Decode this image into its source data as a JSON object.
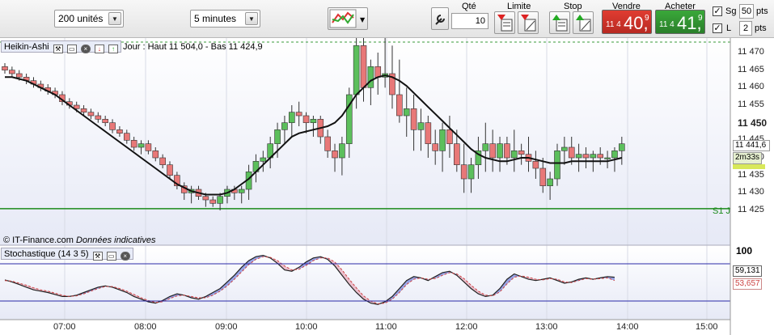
{
  "toolbar": {
    "units_select": "200 unités",
    "interval_select": "5 minutes",
    "qty_label": "Qté",
    "qty_value": "10",
    "limit_label": "Limite",
    "stop_label": "Stop",
    "sell_label": "Vendre",
    "buy_label": "Acheter",
    "sell_price_small": "11 4",
    "sell_price_big": "40,",
    "sell_price_sup": "9",
    "buy_price_small": "11 4",
    "buy_price_big": "41,",
    "buy_price_sup": "9",
    "sg_label": "Sg",
    "sg_value": "50",
    "sg_unit": "pts",
    "l_label": "L",
    "l_value": "2",
    "l_unit": "pts",
    "sell_color": "#e03c31",
    "buy_color": "#3aa83a"
  },
  "price_panel": {
    "title": "Heikin-Ashi",
    "info": "Jour : Haut 11 504,0 - Bas 11 424,9",
    "watermark_source": "© IT-Finance.com",
    "watermark_note": "Données indicatives",
    "support_label": "S1 J",
    "last_price": "11 441,6",
    "countdown": "2m33s",
    "y_ticks": [
      "11 470",
      "11 465",
      "11 460",
      "11 455",
      "11 450",
      "11 445",
      "11 440",
      "11 435",
      "11 430",
      "11 425"
    ],
    "bold_tick": "11 450"
  },
  "stoch_panel": {
    "title": "Stochastique (14 3 5)",
    "top_tick": "100",
    "k_value": "59,131",
    "d_value": "53,657"
  },
  "x_ticks": [
    "07:00",
    "08:00",
    "09:00",
    "10:00",
    "11:00",
    "12:00",
    "13:00",
    "14:00",
    "15:00"
  ],
  "chart_data": {
    "type": "candlestick",
    "ylim": [
      11422,
      11473
    ],
    "up_color": "#5cbf5c",
    "down_color": "#e87878",
    "candles": [
      [
        11466,
        11467,
        11464,
        11465
      ],
      [
        11465,
        11466,
        11463,
        11464
      ],
      [
        11464,
        11465,
        11462,
        11463
      ],
      [
        11463,
        11464,
        11461,
        11462
      ],
      [
        11462,
        11463,
        11460,
        11461
      ],
      [
        11461,
        11462,
        11459,
        11460
      ],
      [
        11460,
        11461,
        11458,
        11459
      ],
      [
        11459,
        11460,
        11457,
        11458
      ],
      [
        11458,
        11459,
        11455,
        11456
      ],
      [
        11456,
        11457,
        11454,
        11455
      ],
      [
        11455,
        11456,
        11453,
        11454
      ],
      [
        11454,
        11455,
        11452,
        11453
      ],
      [
        11453,
        11454,
        11451,
        11452
      ],
      [
        11452,
        11453,
        11450,
        11451
      ],
      [
        11451,
        11452,
        11449,
        11450
      ],
      [
        11450,
        11451,
        11447,
        11448
      ],
      [
        11448,
        11449,
        11446,
        11447
      ],
      [
        11447,
        11448,
        11444,
        11445
      ],
      [
        11445,
        11446,
        11442,
        11443
      ],
      [
        11443,
        11445,
        11441,
        11444
      ],
      [
        11444,
        11445,
        11441,
        11442
      ],
      [
        11442,
        11443,
        11439,
        11440
      ],
      [
        11440,
        11441,
        11437,
        11438
      ],
      [
        11438,
        11439,
        11434,
        11435
      ],
      [
        11435,
        11436,
        11431,
        11432
      ],
      [
        11432,
        11433,
        11428,
        11430
      ],
      [
        11430,
        11432,
        11427,
        11431
      ],
      [
        11431,
        11432,
        11428,
        11429
      ],
      [
        11429,
        11430,
        11426,
        11428
      ],
      [
        11428,
        11429,
        11426,
        11427
      ],
      [
        11427,
        11430,
        11425,
        11429
      ],
      [
        11429,
        11432,
        11427,
        11431
      ],
      [
        11431,
        11432,
        11428,
        11430
      ],
      [
        11430,
        11432,
        11427,
        11431
      ],
      [
        11431,
        11438,
        11428,
        11436
      ],
      [
        11436,
        11441,
        11433,
        11439
      ],
      [
        11439,
        11442,
        11436,
        11440
      ],
      [
        11440,
        11446,
        11437,
        11444
      ],
      [
        11444,
        11450,
        11440,
        11448
      ],
      [
        11448,
        11452,
        11444,
        11450
      ],
      [
        11450,
        11455,
        11446,
        11453
      ],
      [
        11453,
        11456,
        11449,
        11452
      ],
      [
        11452,
        11453,
        11447,
        11450
      ],
      [
        11450,
        11452,
        11446,
        11451
      ],
      [
        11451,
        11452,
        11444,
        11446
      ],
      [
        11446,
        11448,
        11440,
        11442
      ],
      [
        11442,
        11444,
        11436,
        11440
      ],
      [
        11440,
        11446,
        11435,
        11444
      ],
      [
        11444,
        11460,
        11440,
        11458
      ],
      [
        11458,
        11475,
        11454,
        11472
      ],
      [
        11472,
        11476,
        11456,
        11460
      ],
      [
        11460,
        11468,
        11455,
        11466
      ],
      [
        11466,
        11470,
        11458,
        11463
      ],
      [
        11463,
        11475,
        11460,
        11464
      ],
      [
        11464,
        11472,
        11454,
        11458
      ],
      [
        11458,
        11468,
        11450,
        11452
      ],
      [
        11452,
        11460,
        11446,
        11454
      ],
      [
        11454,
        11458,
        11442,
        11448
      ],
      [
        11448,
        11454,
        11442,
        11450
      ],
      [
        11450,
        11452,
        11440,
        11444
      ],
      [
        11444,
        11448,
        11438,
        11442
      ],
      [
        11442,
        11450,
        11436,
        11448
      ],
      [
        11448,
        11452,
        11440,
        11444
      ],
      [
        11444,
        11448,
        11436,
        11438
      ],
      [
        11438,
        11444,
        11430,
        11434
      ],
      [
        11434,
        11440,
        11430,
        11438
      ],
      [
        11438,
        11446,
        11434,
        11442
      ],
      [
        11442,
        11450,
        11436,
        11444
      ],
      [
        11444,
        11448,
        11436,
        11440
      ],
      [
        11440,
        11446,
        11436,
        11444
      ],
      [
        11444,
        11446,
        11438,
        11440
      ],
      [
        11440,
        11448,
        11436,
        11442
      ],
      [
        11442,
        11444,
        11438,
        11441
      ],
      [
        11441,
        11446,
        11436,
        11439
      ],
      [
        11439,
        11442,
        11434,
        11437
      ],
      [
        11437,
        11440,
        11430,
        11432
      ],
      [
        11432,
        11436,
        11428,
        11434
      ],
      [
        11434,
        11444,
        11432,
        11442
      ],
      [
        11442,
        11446,
        11438,
        11443
      ],
      [
        11443,
        11446,
        11438,
        11440
      ],
      [
        11440,
        11444,
        11436,
        11441
      ],
      [
        11441,
        11443,
        11437,
        11440
      ],
      [
        11440,
        11442,
        11436,
        11441
      ],
      [
        11441,
        11443,
        11438,
        11440
      ],
      [
        11440,
        11442,
        11437,
        11440
      ],
      [
        11440,
        11443,
        11436,
        11442
      ],
      [
        11442,
        11446,
        11438,
        11444
      ]
    ],
    "ma_series": [
      11463,
      11463,
      11462.5,
      11462,
      11461,
      11460,
      11459,
      11458,
      11456.5,
      11455,
      11453.5,
      11452,
      11450.5,
      11449,
      11447.5,
      11446,
      11444.5,
      11443,
      11441.5,
      11440,
      11438.5,
      11437,
      11435.5,
      11434,
      11432.5,
      11431.5,
      11430.5,
      11430,
      11429.5,
      11429.5,
      11429.5,
      11430,
      11431,
      11432.5,
      11434,
      11436,
      11438,
      11440,
      11442,
      11444,
      11446,
      11447,
      11447.5,
      11448,
      11448.5,
      11449,
      11450,
      11452,
      11455,
      11458,
      11460,
      11462,
      11463,
      11463.5,
      11463,
      11462,
      11460.5,
      11458.5,
      11456.5,
      11454.5,
      11452.5,
      11450.5,
      11448.5,
      11446.5,
      11444.5,
      11442.5,
      11441,
      11440,
      11439.5,
      11439,
      11439,
      11439.5,
      11440,
      11440,
      11439.5,
      11439,
      11438.5,
      11438.5,
      11438.5,
      11439,
      11439,
      11439,
      11439,
      11439,
      11439,
      11439.5,
      11440
    ],
    "support": 11425.5,
    "stoch_k": [
      55,
      52,
      48,
      44,
      40,
      38,
      36,
      33,
      30,
      30,
      32,
      36,
      40,
      44,
      46,
      44,
      40,
      36,
      30,
      26,
      22,
      20,
      24,
      30,
      34,
      32,
      28,
      26,
      30,
      36,
      42,
      52,
      62,
      74,
      84,
      90,
      92,
      88,
      80,
      70,
      68,
      74,
      82,
      88,
      90,
      86,
      76,
      62,
      48,
      36,
      26,
      20,
      18,
      22,
      30,
      42,
      54,
      60,
      58,
      54,
      60,
      66,
      68,
      62,
      52,
      42,
      34,
      30,
      32,
      42,
      56,
      64,
      60,
      56,
      54,
      56,
      58,
      54,
      50,
      52,
      56,
      58,
      56,
      58,
      60,
      59
    ],
    "stoch_d": [
      54,
      53,
      50,
      47,
      43,
      40,
      38,
      35,
      32,
      30,
      31,
      34,
      38,
      42,
      45,
      45,
      42,
      38,
      33,
      28,
      24,
      21,
      22,
      27,
      31,
      32,
      30,
      28,
      28,
      32,
      38,
      46,
      56,
      67,
      78,
      86,
      90,
      89,
      84,
      76,
      70,
      71,
      77,
      84,
      88,
      88,
      82,
      70,
      56,
      43,
      31,
      23,
      19,
      20,
      26,
      36,
      48,
      56,
      58,
      56,
      57,
      62,
      66,
      64,
      57,
      47,
      38,
      32,
      31,
      37,
      49,
      59,
      61,
      59,
      56,
      55,
      57,
      56,
      52,
      51,
      54,
      57,
      56,
      57,
      58,
      54
    ]
  }
}
